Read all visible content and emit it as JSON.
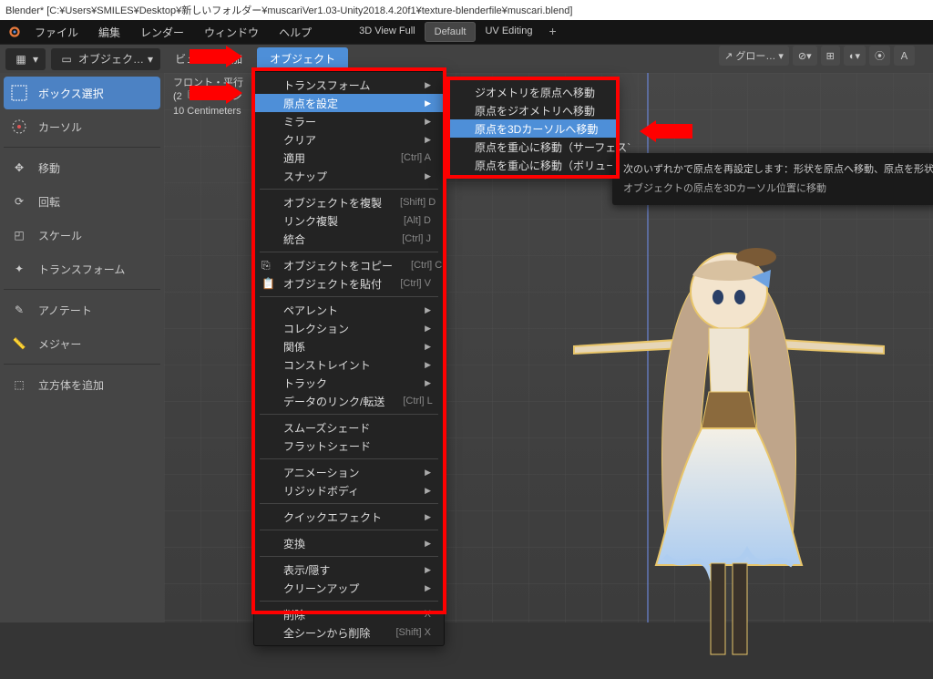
{
  "title": "Blender* [C:¥Users¥SMILES¥Desktop¥新しいフォルダー¥muscariVer1.03-Unity2018.4.20f1¥texture-blenderfile¥muscari.blend]",
  "menubar": {
    "file": "ファイル",
    "edit": "編集",
    "render": "レンダー",
    "window": "ウィンドウ",
    "help": "ヘルプ"
  },
  "workspaces": {
    "full": "3D View Full",
    "def": "Default",
    "uv": "UV Editing"
  },
  "header": {
    "mode": "オブジェク…",
    "view": "ビュー",
    "add": "加",
    "object": "オブジェクト",
    "global": "グロー…"
  },
  "tools": {
    "box": "ボックス選択",
    "cursor": "カーソル",
    "move": "移動",
    "rotate": "回転",
    "scale": "スケール",
    "transform": "トランスフォーム",
    "annotate": "アノテート",
    "measure": "メジャー",
    "addcube": "立方体を追加"
  },
  "overlay": {
    "l1": "フロント・平行",
    "l2": "(2『　　　ッシ",
    "l3": "10 Centimeters"
  },
  "object_menu": {
    "transform": "トランスフォーム",
    "set_origin": "原点を設定",
    "mirror": "ミラー",
    "clear": "クリア",
    "apply": "適用",
    "apply_sc": "[Ctrl] A",
    "snap": "スナップ",
    "dup": "オブジェクトを複製",
    "dup_sc": "[Shift] D",
    "dup_link": "リンク複製",
    "dup_link_sc": "[Alt] D",
    "join": "統合",
    "join_sc": "[Ctrl] J",
    "copy": "オブジェクトをコピー",
    "copy_sc": "[Ctrl] C",
    "paste": "オブジェクトを貼付",
    "paste_sc": "[Ctrl] V",
    "parent": "ペアレント",
    "collection": "コレクション",
    "relation": "関係",
    "constraint": "コンストレイント",
    "track": "トラック",
    "link_data": "データのリンク/転送",
    "link_data_sc": "[Ctrl] L",
    "smooth": "スムーズシェード",
    "flat": "フラットシェード",
    "anim": "アニメーション",
    "rigid": "リジッドボディ",
    "quick": "クイックエフェクト",
    "convert": "変換",
    "show": "表示/隠す",
    "cleanup": "クリーンアップ",
    "delete": "削除",
    "delete_sc": "X",
    "delete_all": "全シーンから削除",
    "delete_all_sc": "[Shift] X"
  },
  "origin_submenu": {
    "geom_to_origin": "ジオメトリを原点へ移動",
    "origin_to_geom": "原点をジオメトリへ移動",
    "origin_to_cursor": "原点を3Dカーソルへ移動",
    "origin_to_com_surf": "原点を重心に移動（サーフェス`",
    "origin_to_com_vol": "原点を重心に移動（ボリューム`"
  },
  "tooltip": {
    "title": "次のいずれかで原点を再設定します：形状を原点へ移動、原点を形状の中心",
    "sub": "オブジェクトの原点を3Dカーソル位置に移動"
  }
}
